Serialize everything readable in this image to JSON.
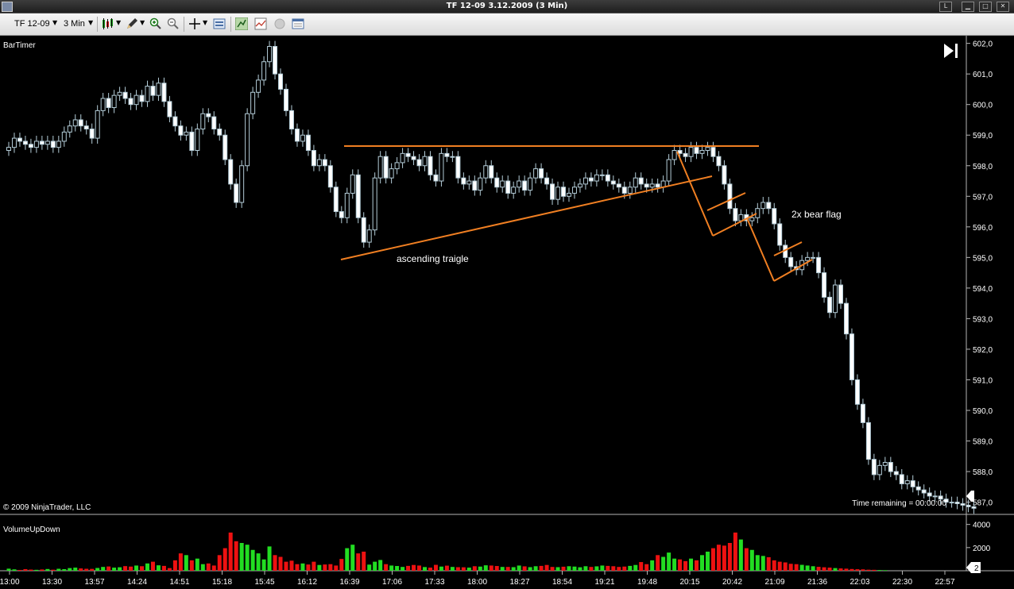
{
  "window": {
    "title": "TF 12-09  3.12.2009 (3 Min)",
    "buttons": [
      "L",
      "▁",
      "□",
      "✕"
    ]
  },
  "toolbar": {
    "instrument": "TF 12-09",
    "interval": "3 Min"
  },
  "price_panel": {
    "indicator_label": "BarTimer",
    "copyright": "© 2009 NinjaTrader, LLC",
    "time_remaining": "Time remaining = 00:00:00",
    "last_price": "586,8",
    "annotations": [
      "ascending traigle",
      "2x bear flag"
    ],
    "colors": {
      "candle": "#b4cdd8",
      "bull_fill": "#000000",
      "bear_fill": "#ffffff",
      "drawing": "#f07f22"
    }
  },
  "volume_panel": {
    "indicator_label": "VolumeUpDown",
    "last_value": "2",
    "colors": {
      "up": "#22dd22",
      "down": "#ee1111"
    }
  },
  "chart_data": [
    {
      "type": "candlestick",
      "title": "TF 12-09  3.12.2009 (3 Min)",
      "ylim": [
        586.6,
        602.25
      ],
      "y_ticks": [
        "602,0",
        "601,0",
        "600,0",
        "599,0",
        "598,0",
        "597,0",
        "596,0",
        "595,0",
        "594,0",
        "593,0",
        "592,0",
        "591,0",
        "590,0",
        "589,0",
        "588,0",
        "587,0"
      ],
      "x_ticks": [
        "13:00",
        "13:30",
        "13:57",
        "14:24",
        "14:51",
        "15:18",
        "15:45",
        "16:12",
        "16:39",
        "17:06",
        "17:33",
        "18:00",
        "18:27",
        "18:54",
        "19:21",
        "19:48",
        "20:15",
        "20:42",
        "21:09",
        "21:36",
        "22:03",
        "22:30",
        "22:57"
      ],
      "close": [
        598.6,
        598.9,
        598.8,
        598.7,
        598.6,
        598.8,
        598.7,
        598.8,
        598.6,
        598.8,
        599.1,
        599.3,
        599.5,
        599.3,
        599.2,
        598.9,
        599.8,
        600.2,
        599.9,
        600.3,
        600.4,
        600.2,
        600.0,
        600.3,
        600.1,
        600.6,
        600.3,
        600.7,
        600.1,
        599.6,
        599.3,
        599.0,
        599.1,
        598.5,
        599.2,
        599.7,
        599.6,
        599.2,
        599.0,
        598.2,
        597.4,
        596.8,
        598.0,
        599.7,
        600.4,
        600.8,
        601.4,
        601.9,
        601.0,
        600.5,
        599.8,
        599.2,
        598.8,
        599.0,
        598.5,
        598.0,
        598.2,
        598.0,
        597.3,
        596.5,
        596.3,
        597.1,
        597.7,
        596.3,
        595.5,
        595.9,
        597.6,
        598.3,
        597.6,
        597.9,
        598.1,
        598.4,
        598.3,
        598.2,
        598.0,
        598.3,
        597.7,
        597.5,
        598.4,
        598.3,
        598.3,
        597.6,
        597.4,
        597.5,
        597.2,
        597.6,
        598.0,
        597.6,
        597.3,
        597.5,
        597.1,
        597.3,
        597.5,
        597.2,
        597.6,
        597.9,
        597.6,
        597.4,
        596.9,
        597.3,
        597.0,
        597.1,
        597.3,
        597.4,
        597.6,
        597.5,
        597.7,
        597.7,
        597.5,
        597.4,
        597.3,
        597.1,
        597.3,
        597.6,
        597.4,
        597.3,
        597.4,
        597.3,
        597.5,
        598.2,
        598.5,
        598.4,
        598.3,
        598.6,
        598.4,
        598.5,
        598.6,
        598.3,
        598.0,
        597.4,
        596.6,
        596.2,
        596.4,
        596.2,
        596.3,
        596.6,
        596.8,
        596.6,
        596.1,
        595.4,
        595.0,
        594.7,
        594.6,
        594.9,
        595.0,
        595.0,
        594.5,
        593.7,
        593.2,
        594.1,
        593.5,
        592.5,
        591.0,
        590.2,
        589.6,
        588.4,
        587.9,
        588.2,
        588.3,
        588.0,
        587.9,
        587.6,
        587.7,
        587.5,
        587.4,
        587.3,
        587.2,
        587.2,
        587.1,
        587.0,
        587.0,
        586.95,
        586.9,
        586.85,
        586.8
      ],
      "annotations": [
        "ascending traigle",
        "2x bear flag"
      ]
    },
    {
      "type": "bar",
      "title": "VolumeUpDown",
      "ylim": [
        0,
        4800
      ],
      "y_ticks": [
        "4000",
        "2000"
      ],
      "series": [
        {
          "name": "up",
          "values": [
            120,
            80,
            40,
            90,
            60,
            50,
            70,
            100,
            60,
            110,
            90,
            150,
            180,
            130,
            110,
            100,
            160,
            220,
            250,
            180,
            200,
            270,
            240,
            300,
            260,
            420,
            520,
            310,
            280,
            150,
            600,
            1000,
            900,
            600,
            700,
            380,
            420,
            300,
            900,
            1300,
            2200,
            1700,
            1600,
            1500,
            1200,
            1000,
            650,
            1400,
            900,
            800,
            520,
            580,
            380,
            420,
            360,
            520,
            330,
            360,
            380,
            300,
            680,
            1300,
            1500,
            1000,
            1100,
            350,
            520,
            620,
            380,
            300,
            270,
            220,
            280,
            330,
            300,
            210,
            180,
            340,
            240,
            290,
            220,
            210,
            200,
            180,
            260,
            240,
            310,
            300,
            270,
            220,
            220,
            210,
            300,
            250,
            210,
            260,
            280,
            330,
            220,
            210,
            230,
            260,
            240,
            200,
            260,
            220,
            250,
            300,
            280,
            260,
            220,
            240,
            280,
            330,
            500,
            380,
            600,
            900,
            800,
            1050,
            700,
            650,
            550,
            700,
            600,
            900,
            1100,
            1300,
            1500,
            1450,
            1600,
            2200,
            1800,
            1300,
            1200,
            900,
            850,
            780,
            600,
            520,
            480,
            400,
            380,
            340,
            300,
            260,
            230,
            200,
            180,
            150,
            130,
            120,
            100,
            90,
            80,
            60,
            50,
            40,
            30
          ]
        },
        {
          "name": "down",
          "values": [
            60,
            40,
            30,
            50,
            40,
            30,
            40,
            50,
            30,
            60,
            50,
            80,
            90,
            70,
            60,
            60,
            80,
            110,
            120,
            90,
            100,
            130,
            120,
            150,
            130,
            210,
            260,
            160,
            140,
            80,
            300,
            500,
            450,
            300,
            350,
            190,
            210,
            150,
            450,
            650,
            1100,
            850,
            800,
            750,
            600,
            500,
            330,
            700,
            450,
            400,
            260,
            290,
            190,
            210,
            180,
            260,
            170,
            180,
            190,
            150,
            340,
            650,
            750,
            500,
            550,
            180,
            260,
            310,
            190,
            150,
            140,
            110,
            140,
            170,
            150,
            110,
            90,
            170,
            120,
            150,
            110,
            100,
            100,
            90,
            130,
            120,
            160,
            150,
            140,
            110,
            110,
            100,
            150,
            130,
            100,
            130,
            140,
            170,
            110,
            100,
            120,
            130,
            120,
            100,
            130,
            110,
            130,
            150,
            140,
            130,
            110,
            120,
            140,
            170,
            250,
            190,
            300,
            450,
            400,
            520,
            350,
            330,
            280,
            350,
            300,
            450,
            550,
            650,
            750,
            720,
            800,
            1100,
            900,
            650,
            600,
            450,
            430,
            390,
            300,
            260,
            240,
            200,
            190,
            170,
            150,
            130,
            110,
            100,
            90,
            80,
            70,
            60,
            50,
            40,
            40,
            30,
            30,
            20,
            20
          ]
        }
      ]
    }
  ]
}
